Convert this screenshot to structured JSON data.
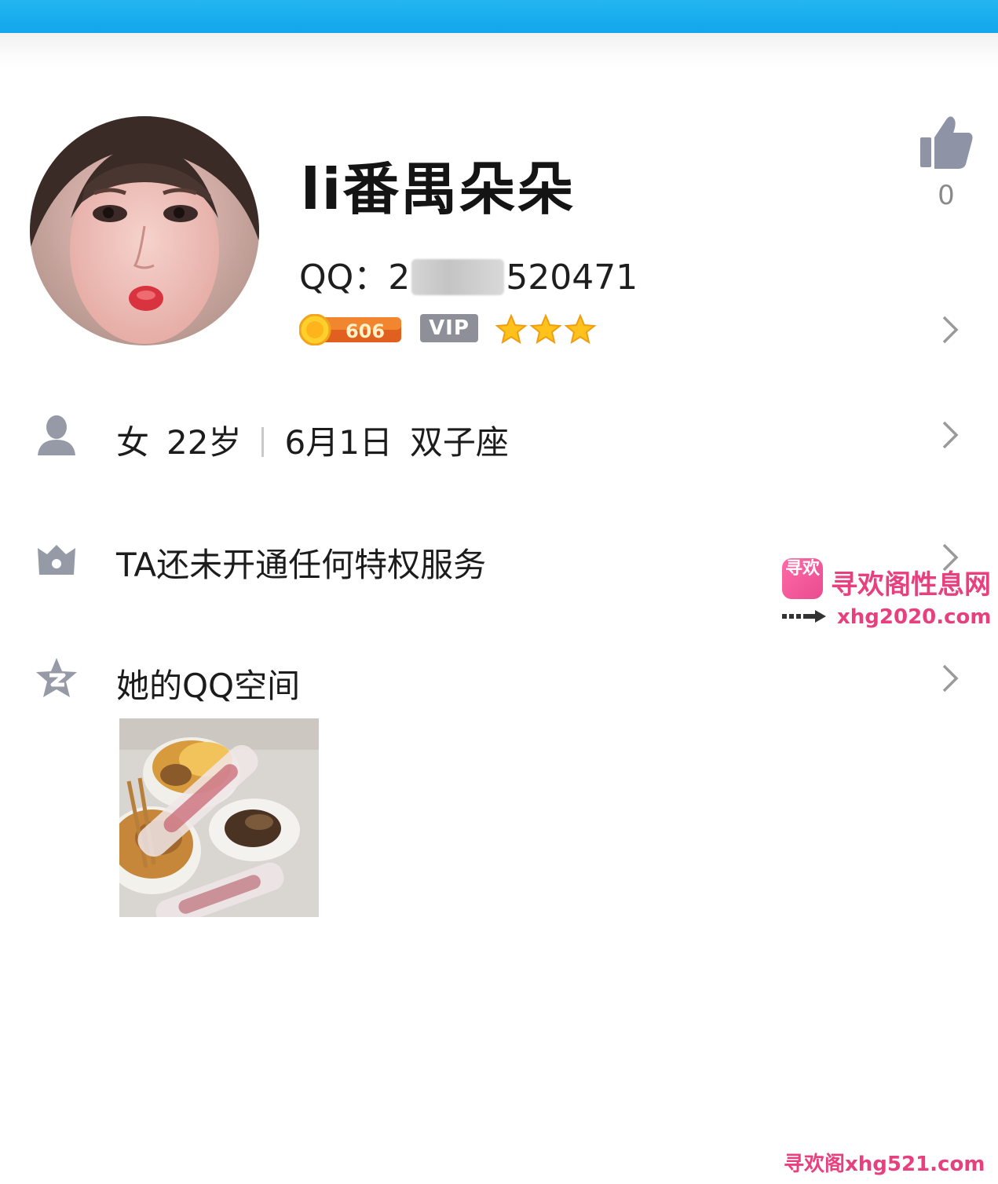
{
  "profile": {
    "nickname": "li番禺朵朵",
    "qq_label": "QQ：",
    "qq_prefix": "2",
    "qq_suffix": "520471",
    "level_number": "606",
    "vip_label": "VIP",
    "star_count": 3,
    "like_count": "0"
  },
  "info_rows": {
    "basic": {
      "gender": "女",
      "age": "22岁",
      "birthday": "6月1日",
      "zodiac": "双子座"
    },
    "privilege": {
      "text": "TA还未开通任何特权服务"
    },
    "qzone": {
      "text": "她的QQ空间"
    }
  },
  "watermarks": {
    "site_logo_text": "寻欢",
    "site_title": "寻欢阁性息网",
    "site_url": "xhg2020.com",
    "bottom_text": "寻欢阁xhg521.com"
  },
  "colors": {
    "topbar": "#19aaee",
    "icon_gray": "#9699a6",
    "watermark_pink": "#e8407f",
    "badge_orange": "#f07a1e"
  },
  "icons": {
    "like": "thumbs-up-icon",
    "person": "person-icon",
    "crown": "crown-icon",
    "qzone": "qzone-star-icon",
    "chevron": "chevron-right-icon"
  }
}
